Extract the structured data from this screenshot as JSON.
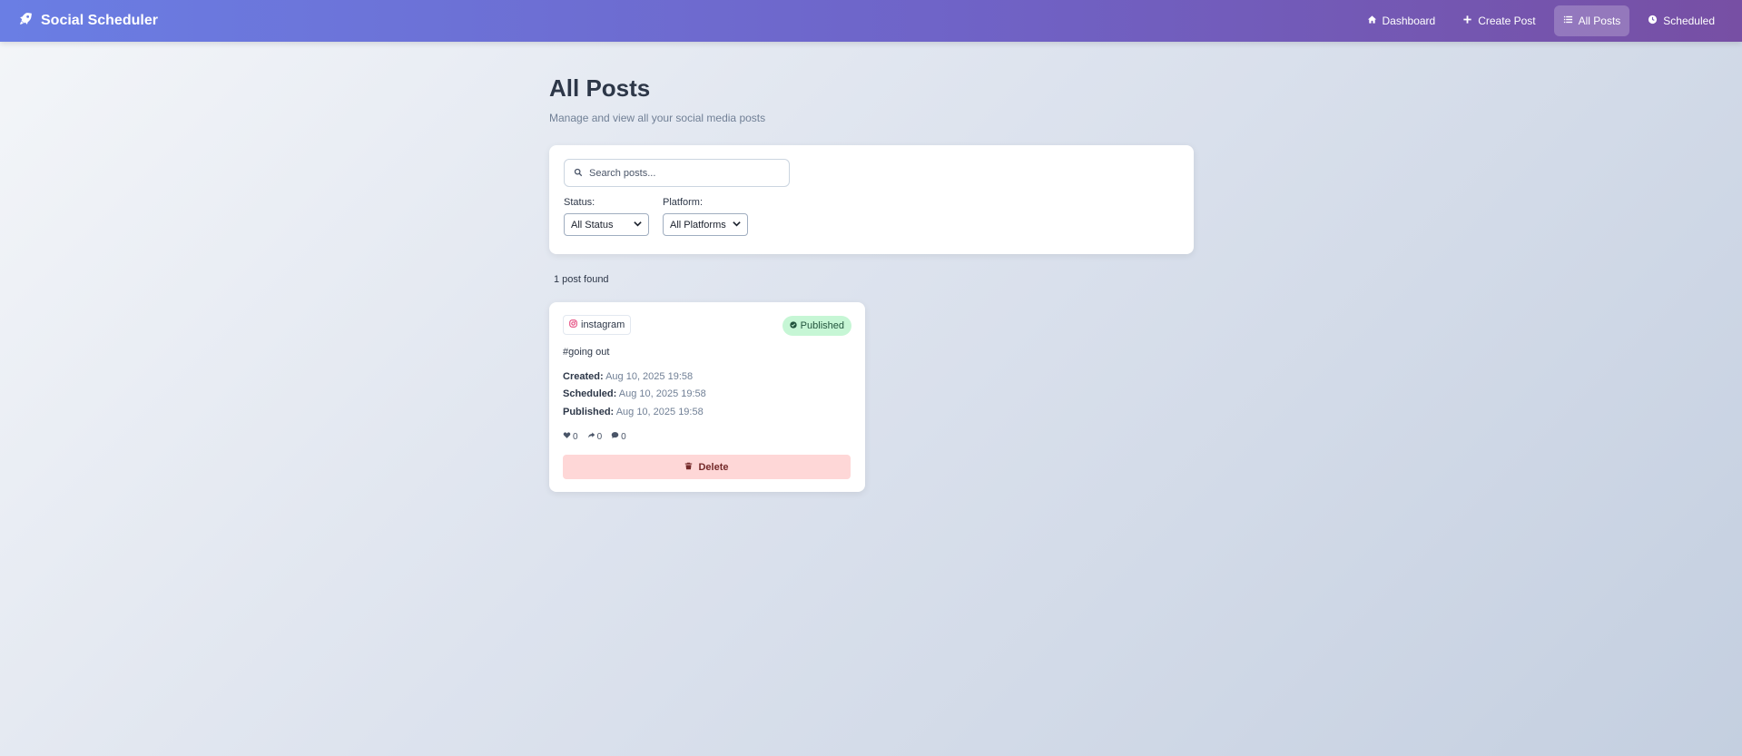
{
  "app": {
    "title": "Social Scheduler",
    "logo_icon": "rocket-icon"
  },
  "nav": {
    "items": [
      {
        "label": "Dashboard",
        "icon": "home-icon",
        "active": false
      },
      {
        "label": "Create Post",
        "icon": "plus-icon",
        "active": false
      },
      {
        "label": "All Posts",
        "icon": "list-icon",
        "active": true
      },
      {
        "label": "Scheduled",
        "icon": "clock-icon",
        "active": false
      }
    ]
  },
  "page": {
    "title": "All Posts",
    "subtitle": "Manage and view all your social media posts"
  },
  "filters": {
    "search_placeholder": "Search posts...",
    "search_value": "",
    "status_label": "Status:",
    "status_value": "All Status",
    "platform_label": "Platform:",
    "platform_value": "All Platforms"
  },
  "results": {
    "count_text": "1 post found"
  },
  "posts": [
    {
      "platform": "instagram",
      "status": "Published",
      "content": "#going out",
      "created_label": "Created:",
      "created": "Aug 10, 2025 19:58",
      "scheduled_label": "Scheduled:",
      "scheduled": "Aug 10, 2025 19:58",
      "published_label": "Published:",
      "published": "Aug 10, 2025 19:58",
      "likes": "0",
      "shares": "0",
      "comments": "0",
      "delete_label": "Delete"
    }
  ],
  "colors": {
    "nav_gradient_start": "#6a7ee4",
    "nav_gradient_end": "#774fa4",
    "published_badge_bg": "#c6f6d5",
    "published_badge_text": "#22543d",
    "delete_bg": "#fed7d7",
    "delete_text": "#742a2a",
    "instagram": "#e1306c"
  }
}
